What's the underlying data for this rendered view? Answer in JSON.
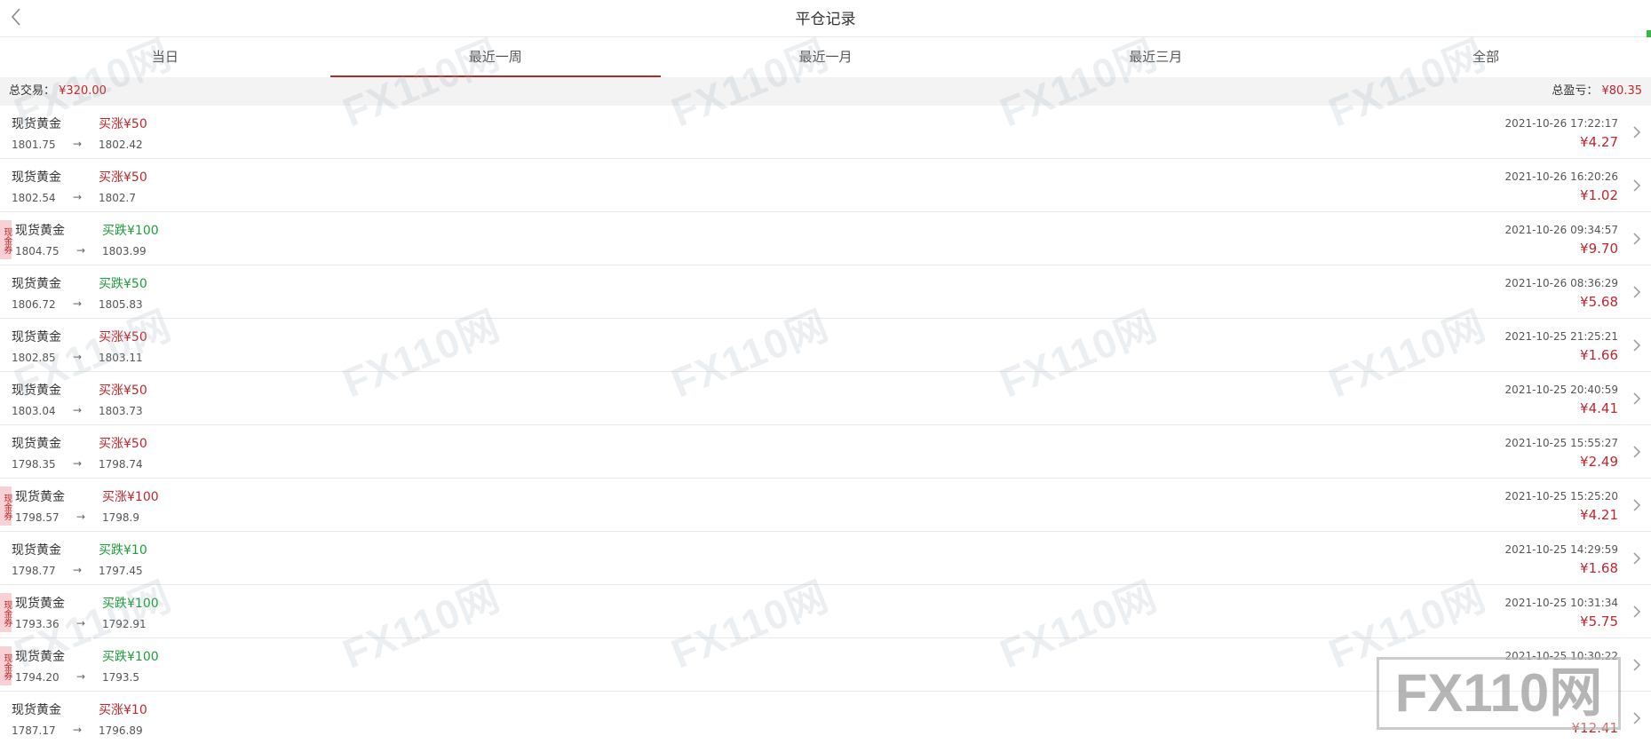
{
  "header": {
    "title": "平仓记录"
  },
  "tabs": [
    "当日",
    "最近一周",
    "最近一月",
    "最近三月",
    "全部"
  ],
  "active_tab": 1,
  "summary": {
    "total_trade_label": "总交易：",
    "total_trade_value": "¥320.00",
    "total_pl_label": "总盈亏：",
    "total_pl_value": "¥80.35"
  },
  "coupon_label": "现金券",
  "arrow": "→",
  "rows": [
    {
      "product": "现货黄金",
      "direction": "买涨¥50",
      "dir_type": "up",
      "coupon": false,
      "open": "1801.75",
      "close": "1802.42",
      "time": "2021-10-26 17:22:17",
      "profit": "¥4.27"
    },
    {
      "product": "现货黄金",
      "direction": "买涨¥50",
      "dir_type": "up",
      "coupon": false,
      "open": "1802.54",
      "close": "1802.7",
      "time": "2021-10-26 16:20:26",
      "profit": "¥1.02"
    },
    {
      "product": "现货黄金",
      "direction": "买跌¥100",
      "dir_type": "down",
      "coupon": true,
      "open": "1804.75",
      "close": "1803.99",
      "time": "2021-10-26 09:34:57",
      "profit": "¥9.70"
    },
    {
      "product": "现货黄金",
      "direction": "买跌¥50",
      "dir_type": "down",
      "coupon": false,
      "open": "1806.72",
      "close": "1805.83",
      "time": "2021-10-26 08:36:29",
      "profit": "¥5.68"
    },
    {
      "product": "现货黄金",
      "direction": "买涨¥50",
      "dir_type": "up",
      "coupon": false,
      "open": "1802.85",
      "close": "1803.11",
      "time": "2021-10-25 21:25:21",
      "profit": "¥1.66"
    },
    {
      "product": "现货黄金",
      "direction": "买涨¥50",
      "dir_type": "up",
      "coupon": false,
      "open": "1803.04",
      "close": "1803.73",
      "time": "2021-10-25 20:40:59",
      "profit": "¥4.41"
    },
    {
      "product": "现货黄金",
      "direction": "买涨¥50",
      "dir_type": "up",
      "coupon": false,
      "open": "1798.35",
      "close": "1798.74",
      "time": "2021-10-25 15:55:27",
      "profit": "¥2.49"
    },
    {
      "product": "现货黄金",
      "direction": "买涨¥100",
      "dir_type": "up",
      "coupon": true,
      "open": "1798.57",
      "close": "1798.9",
      "time": "2021-10-25 15:25:20",
      "profit": "¥4.21"
    },
    {
      "product": "现货黄金",
      "direction": "买跌¥10",
      "dir_type": "down",
      "coupon": false,
      "open": "1798.77",
      "close": "1797.45",
      "time": "2021-10-25 14:29:59",
      "profit": "¥1.68"
    },
    {
      "product": "现货黄金",
      "direction": "买跌¥100",
      "dir_type": "down",
      "coupon": true,
      "open": "1793.36",
      "close": "1792.91",
      "time": "2021-10-25 10:31:34",
      "profit": "¥5.75"
    },
    {
      "product": "现货黄金",
      "direction": "买跌¥100",
      "dir_type": "down",
      "coupon": true,
      "open": "1794.20",
      "close": "1793.5",
      "time": "2021-10-25 10:30:22",
      "profit": ""
    },
    {
      "product": "现货黄金",
      "direction": "买涨¥10",
      "dir_type": "up",
      "coupon": false,
      "open": "1787.17",
      "close": "1796.89",
      "time": "",
      "profit": "¥12.41"
    }
  ],
  "colors": {
    "accent_red": "#c0272d",
    "green": "#1f9d3a",
    "tab_underline": "#b12a2e"
  },
  "watermark": {
    "text": "FX110网"
  },
  "icons": {
    "back": "chevron-left-icon",
    "row_chevron": "chevron-right-icon"
  }
}
